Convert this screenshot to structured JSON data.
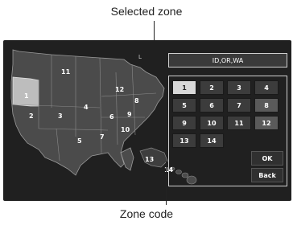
{
  "callouts": {
    "top": "Selected zone",
    "bottom": "Zone code"
  },
  "zone_display": {
    "value": "ID,OR,WA"
  },
  "zone_buttons": [
    {
      "label": "1",
      "selected": true
    },
    {
      "label": "2"
    },
    {
      "label": "3"
    },
    {
      "label": "4"
    },
    {
      "label": "5"
    },
    {
      "label": "6"
    },
    {
      "label": "7"
    },
    {
      "label": "8"
    },
    {
      "label": "9"
    },
    {
      "label": "10"
    },
    {
      "label": "11"
    },
    {
      "label": "12"
    },
    {
      "label": "13"
    },
    {
      "label": "14"
    }
  ],
  "action_buttons": {
    "ok": "OK",
    "back": "Back"
  },
  "map_labels": [
    "11",
    "12",
    "1",
    "8",
    "4",
    "2",
    "3",
    "6",
    "9",
    "10",
    "7",
    "5",
    "13",
    "14"
  ],
  "map_corner_mark": "L"
}
